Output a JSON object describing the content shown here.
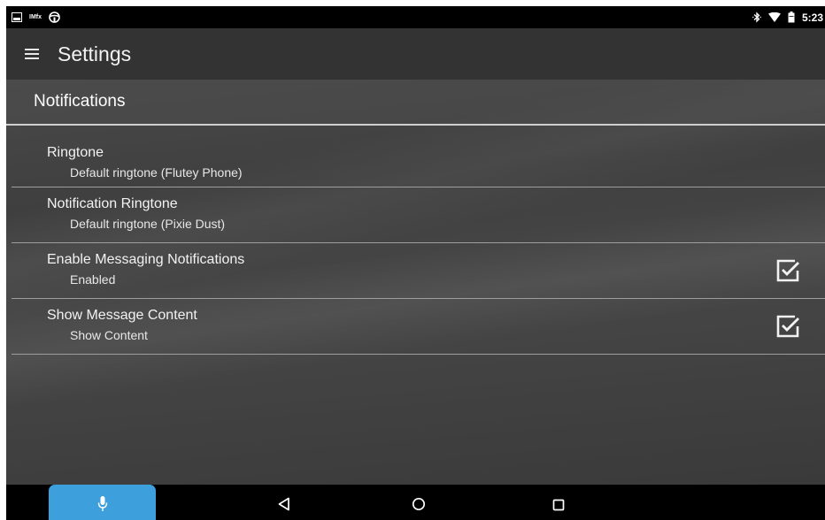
{
  "status_bar": {
    "time": "5:23",
    "left_icons": [
      "screenshot-icon",
      "imfx-icon",
      "steering-wheel-icon"
    ],
    "imfx_label": "IMfx",
    "right_icons": [
      "bluetooth-icon",
      "wifi-icon",
      "battery-icon"
    ]
  },
  "toolbar": {
    "title": "Settings",
    "menu_icon": "hamburger-menu-icon"
  },
  "category": {
    "title": "Notifications"
  },
  "preferences": [
    {
      "title": "Ringtone",
      "summary": "Default ringtone (Flutey Phone)"
    },
    {
      "title": "Notification Ringtone",
      "summary": "Default ringtone (Pixie Dust)"
    },
    {
      "title": "Enable Messaging Notifications",
      "summary": "Enabled",
      "checked": true
    },
    {
      "title": "Show Message Content",
      "summary": "Show Content",
      "checked": true
    }
  ],
  "nav_bar": {
    "buttons": [
      "microphone-icon",
      "back-icon",
      "home-icon",
      "recents-icon"
    ],
    "accent_color": "#3d9fdb"
  }
}
